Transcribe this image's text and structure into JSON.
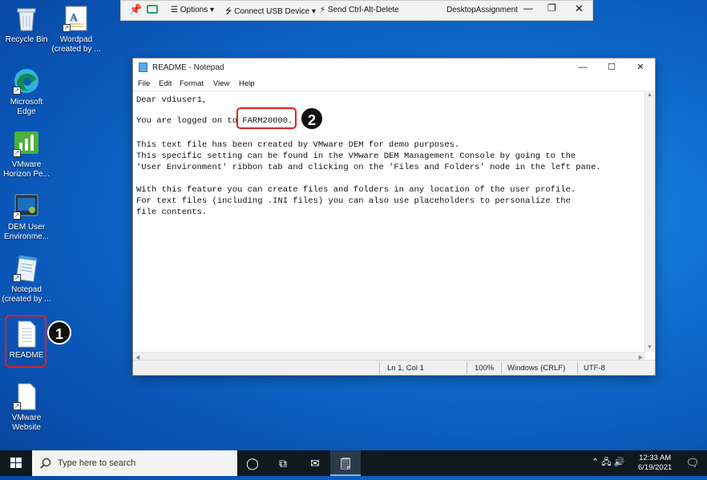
{
  "desktop": {
    "icons": [
      {
        "label": "Recycle Bin"
      },
      {
        "label": "Wordpad (created by ..."
      },
      {
        "label": "Microsoft Edge"
      },
      {
        "label": "VMware Horizon Pe..."
      },
      {
        "label": "DEM User Environme..."
      },
      {
        "label": "Notepad (created by ..."
      },
      {
        "label": "README"
      },
      {
        "label": "VMware Website"
      }
    ]
  },
  "annotations": {
    "badge1": "1",
    "badge2": "2"
  },
  "horizon_toolbar": {
    "options": "Options ▾",
    "connect_usb": "Connect USB Device ▾",
    "send_cad": "Send Ctrl-Alt-Delete",
    "desktop_name": "DesktopAssignment"
  },
  "notepad": {
    "title": "README - Notepad",
    "menu": [
      "File",
      "Edit",
      "Format",
      "View",
      "Help"
    ],
    "lines": [
      "Dear vdiuser1,",
      "",
      "You are logged on to FARM20000.",
      "",
      "This text file has been created by VMware DEM for demo purposes.",
      "This specific setting can be found in the VMware DEM Management Console by going to the",
      "'User Environment' ribbon tab and clicking on the 'Files and Folders' node in the left pane.",
      "",
      "With this feature you can create files and folders in any location of the user profile.",
      "For text files (including .INI files) you can also use placeholders to personalize the",
      "file contents."
    ],
    "status": {
      "position": "Ln 1, Col 1",
      "zoom": "100%",
      "line_ending": "Windows (CRLF)",
      "encoding": "UTF-8"
    }
  },
  "taskbar": {
    "search_placeholder": "Type here to search",
    "time": "12:33 AM",
    "date": "6/19/2021"
  }
}
